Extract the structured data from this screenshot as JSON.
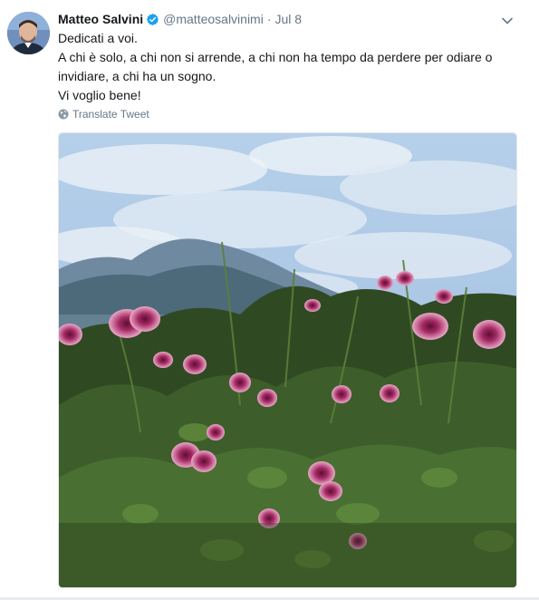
{
  "tweet": {
    "author_name": "Matteo Salvini",
    "handle": "@matteosalvinimi",
    "separator": "·",
    "timestamp": "Jul 8",
    "text_lines": [
      "Dedicati a voi.",
      "A chi è solo, a chi non si arrende, a chi non ha tempo da perdere per odiare o invidiare, a chi ha un sogno.",
      "Vi voglio bene!"
    ],
    "translate_label": "Translate Tweet"
  },
  "icons": {
    "verified": "verified-badge-icon",
    "caret": "chevron-down-icon",
    "globe": "globe-icon"
  },
  "colors": {
    "verified_blue": "#1da1f2",
    "secondary_text": "#657786",
    "flower_magenta": "#c2407a",
    "foliage_green": "#2f4a22",
    "sky_blue": "#a9c8e6"
  }
}
